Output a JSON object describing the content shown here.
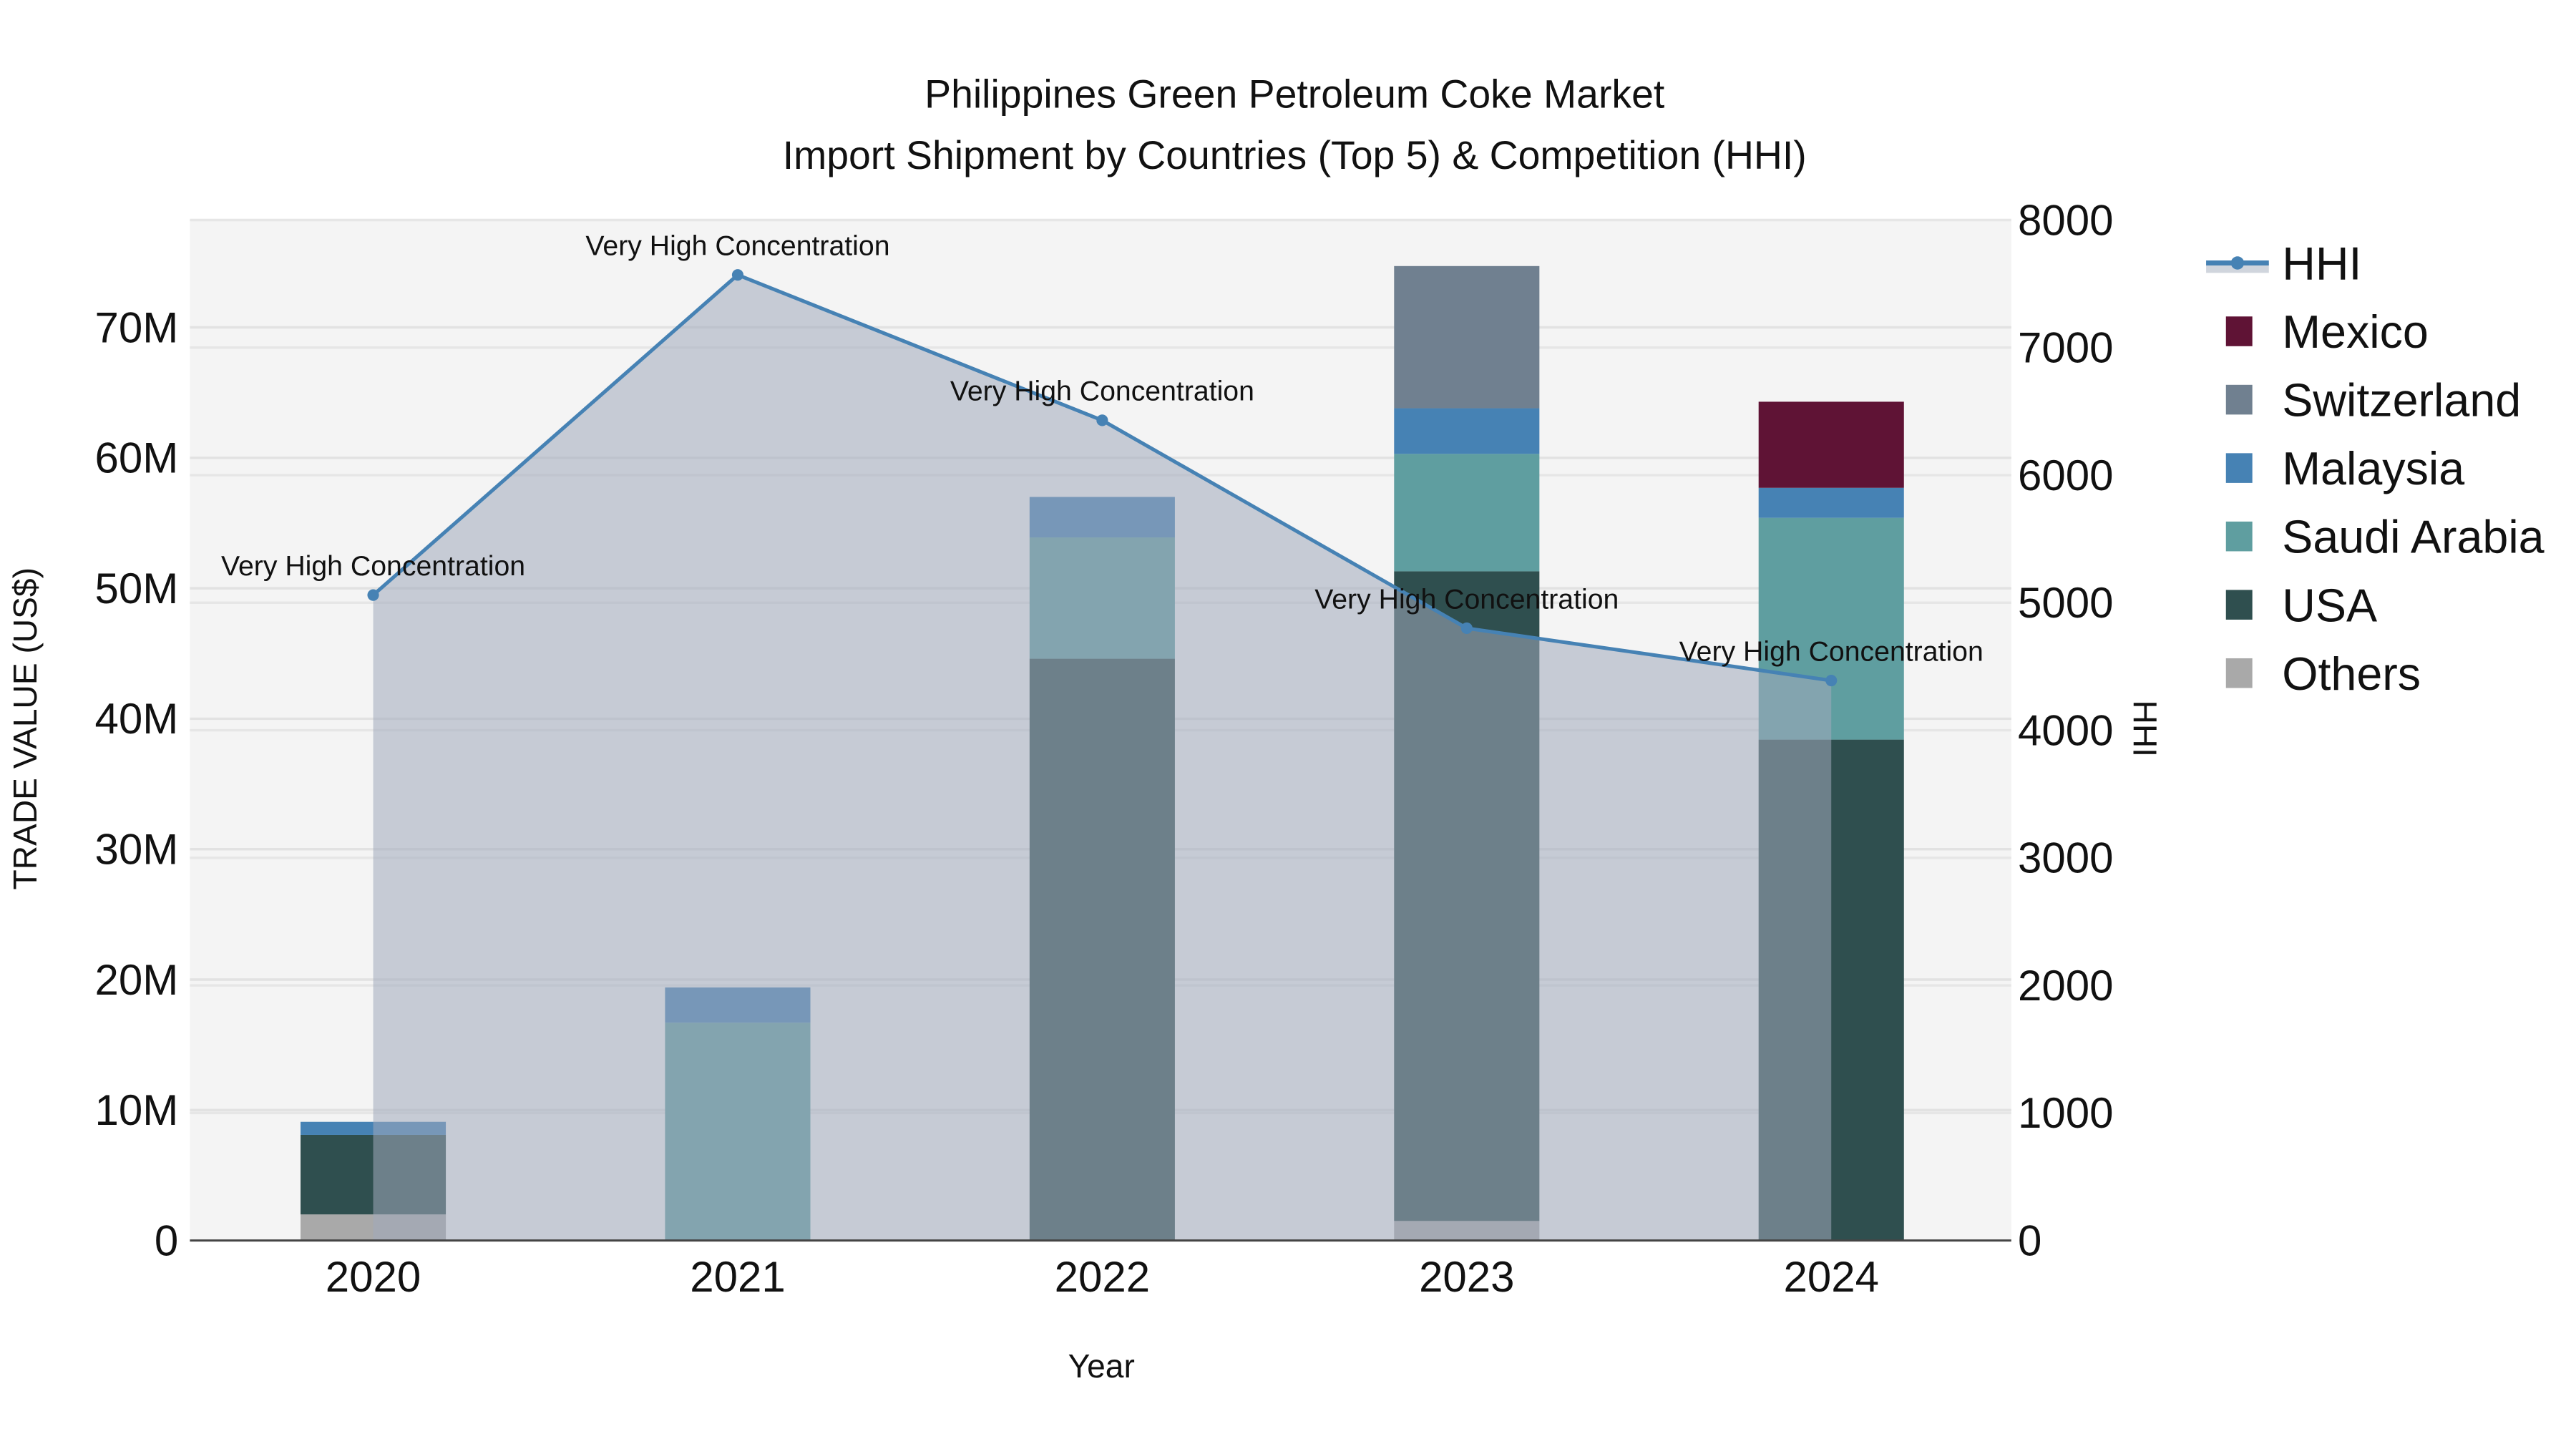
{
  "chart_data": {
    "type": "bar",
    "title": "Philippines Green Petroleum Coke Market",
    "subtitle": "Import Shipment by Countries (Top 5) & Competition (HHI)",
    "xlabel": "Year",
    "ylabel": "TRADE VALUE (US$)",
    "y2label": "HHI",
    "categories": [
      "2020",
      "2021",
      "2022",
      "2023",
      "2024"
    ],
    "ylim": [
      0,
      78
    ],
    "y_ticks": [
      0,
      10,
      20,
      30,
      40,
      50,
      60,
      70
    ],
    "y_tick_labels": [
      "0",
      "10M",
      "20M",
      "30M",
      "40M",
      "50M",
      "60M",
      "70M"
    ],
    "y2lim": [
      0,
      8000
    ],
    "y2_ticks": [
      0,
      1000,
      2000,
      3000,
      4000,
      5000,
      6000,
      7000,
      8000
    ],
    "y2_tick_labels": [
      "0",
      "1000",
      "2000",
      "3000",
      "4000",
      "5000",
      "6000",
      "7000",
      "8000"
    ],
    "units": "US$ millions",
    "grid": true,
    "legend_position": "right",
    "series": [
      {
        "name": "Others",
        "color": "#a9a9a9",
        "values": [
          2.0,
          0,
          0,
          1.5,
          0
        ]
      },
      {
        "name": "USA",
        "color": "#2f4f4f",
        "values": [
          6.1,
          0,
          44.6,
          49.8,
          38.4
        ]
      },
      {
        "name": "Saudi Arabia",
        "color": "#5f9ea0",
        "values": [
          0,
          16.7,
          9.3,
          9.0,
          17.0
        ]
      },
      {
        "name": "Malaysia",
        "color": "#4682b4",
        "values": [
          1.0,
          2.7,
          3.1,
          3.5,
          2.3
        ]
      },
      {
        "name": "Switzerland",
        "color": "#708090",
        "values": [
          0,
          0,
          0,
          10.9,
          0
        ]
      },
      {
        "name": "Mexico",
        "color": "#5f1335",
        "values": [
          0,
          0,
          0,
          0,
          6.6
        ]
      }
    ],
    "hhi": {
      "name": "HHI",
      "type": "line",
      "color": "#4682b4",
      "values": [
        5060,
        7570,
        6430,
        4800,
        4390
      ],
      "annotations": [
        "Very High Concentration",
        "Very High Concentration",
        "Very High Concentration",
        "Very High Concentration",
        "Very High Concentration"
      ]
    },
    "legend": [
      "HHI",
      "Mexico",
      "Switzerland",
      "Malaysia",
      "Saudi Arabia",
      "USA",
      "Others"
    ]
  }
}
